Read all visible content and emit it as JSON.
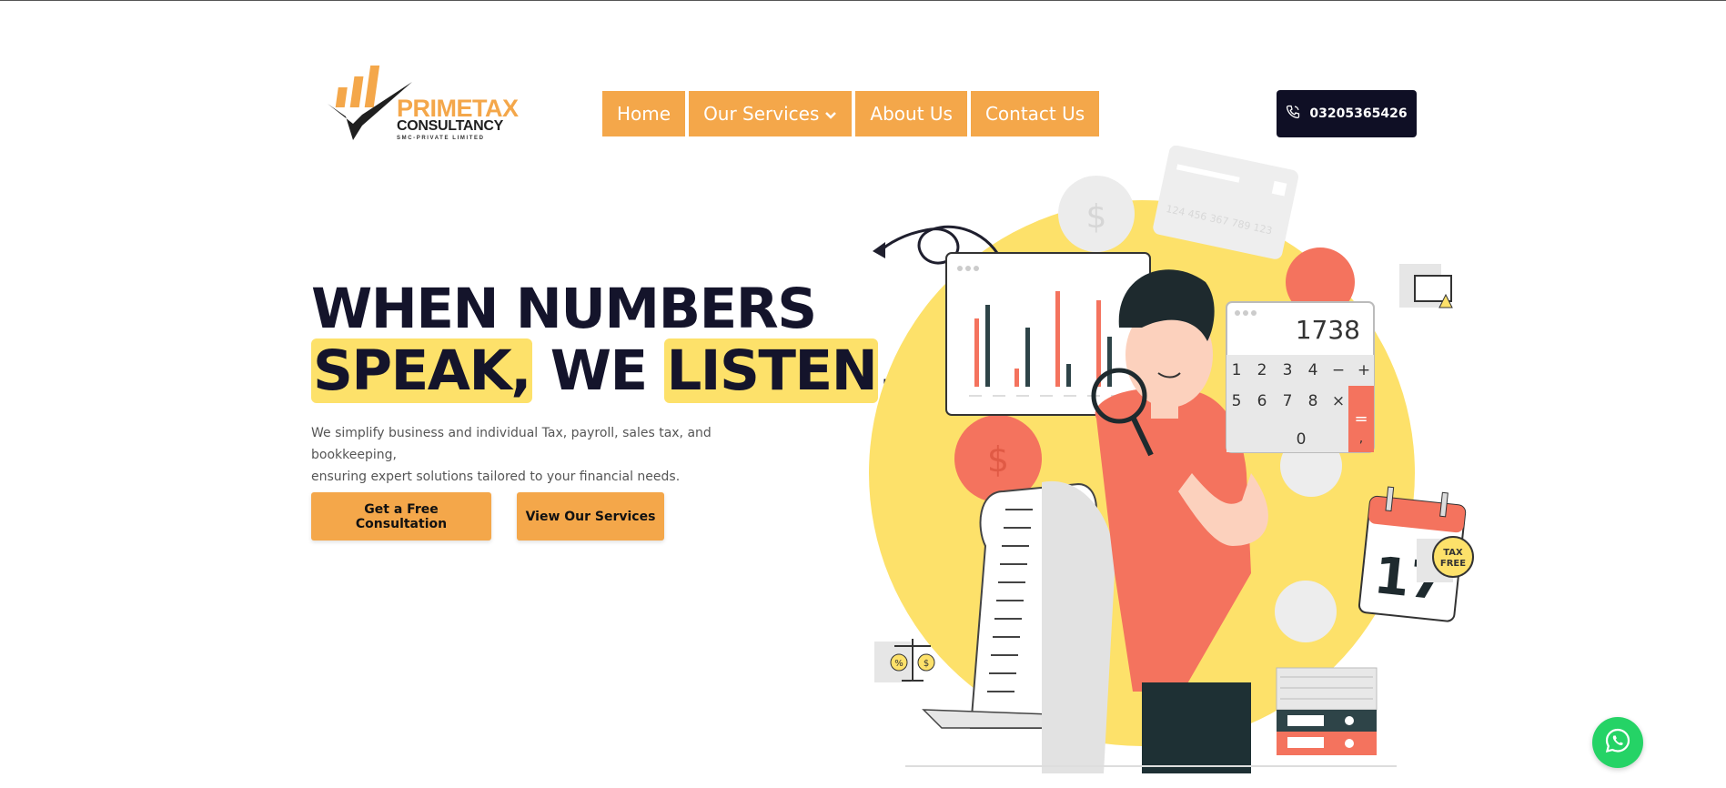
{
  "logo": {
    "line1": "PRIMETAX",
    "line2": "CONSULTANCY",
    "line3": "SMC-PRIVATE LIMITED"
  },
  "nav": {
    "home": "Home",
    "services": "Our Services",
    "about": "About Us",
    "contact": "Contact Us"
  },
  "phone": {
    "number": "03205365426",
    "icon": "phone-icon"
  },
  "hero": {
    "line1": "WHEN NUMBERS",
    "word_speak": "SPEAK,",
    "word_we": "WE",
    "word_listen": "LISTEN",
    "period": ".",
    "description_line1": "We simplify business and individual Tax, payroll, sales tax, and bookkeeping,",
    "description_line2": "ensuring expert solutions tailored to your financial needs.",
    "highlight_color": "#fde16a"
  },
  "buttons": {
    "consult": "Get a Free Consultation",
    "services": "View Our Services"
  },
  "illustration": {
    "calculator_display": "1738",
    "calc_keys_row1": [
      "1",
      "2",
      "3",
      "4",
      "−",
      "+"
    ],
    "calc_keys_row2": [
      "5",
      "6",
      "7",
      "8",
      "×"
    ],
    "calc_key_zero": "0",
    "calc_key_dot": ",",
    "calc_key_equals": "=",
    "calendar_day": "17",
    "card_number": "124 456 367 789 123",
    "badge_line1": "TAX",
    "badge_line2": "FREE",
    "coin_symbol": "$",
    "scale_left": "%",
    "scale_right": "$"
  },
  "colors": {
    "accent": "#f4a74a",
    "dark": "#0f0f25",
    "whatsapp": "#25d366"
  },
  "whatsapp": {
    "icon": "whatsapp-icon"
  }
}
